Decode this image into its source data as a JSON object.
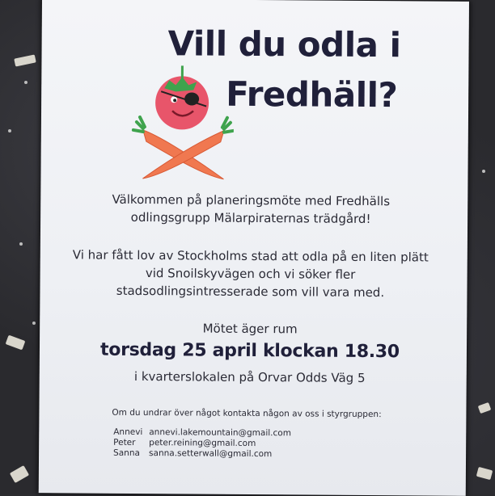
{
  "poster": {
    "title_line1": "Vill du odla i",
    "title_line2": "Fredhäll?",
    "welcome": "Välkommen på planeringsmöte med Fredhälls odlingsgrupp Mälarpiraternas trädgård!",
    "permission": "Vi har fått lov av Stockholms stad att odla på en liten plätt vid Snoilskyvägen och vi söker fler stadsodlingsintresserade som vill vara med.",
    "meeting_label": "Mötet äger rum",
    "date": "torsdag 25 april klockan 18.30",
    "place": "i kvarterslokalen på Orvar Odds Väg 5",
    "contact_intro": "Om du undrar över något kontakta någon av oss i styrgruppen:",
    "contacts": [
      {
        "name": "Annevi",
        "email": "annevi.lakemountain@gmail.com"
      },
      {
        "name": "Peter",
        "email": "peter.reining@gmail.com"
      },
      {
        "name": "Sanna",
        "email": "sanna.setterwall@gmail.com"
      }
    ]
  },
  "colors": {
    "board": "#2a2a2e",
    "paper": "#f1f2f6",
    "text": "#20203a",
    "tomato": "#e8556a",
    "carrot": "#f07850",
    "leaf": "#3fa34d"
  },
  "icons": {
    "mascot": "pirate-tomato-with-crossed-carrots-icon"
  }
}
